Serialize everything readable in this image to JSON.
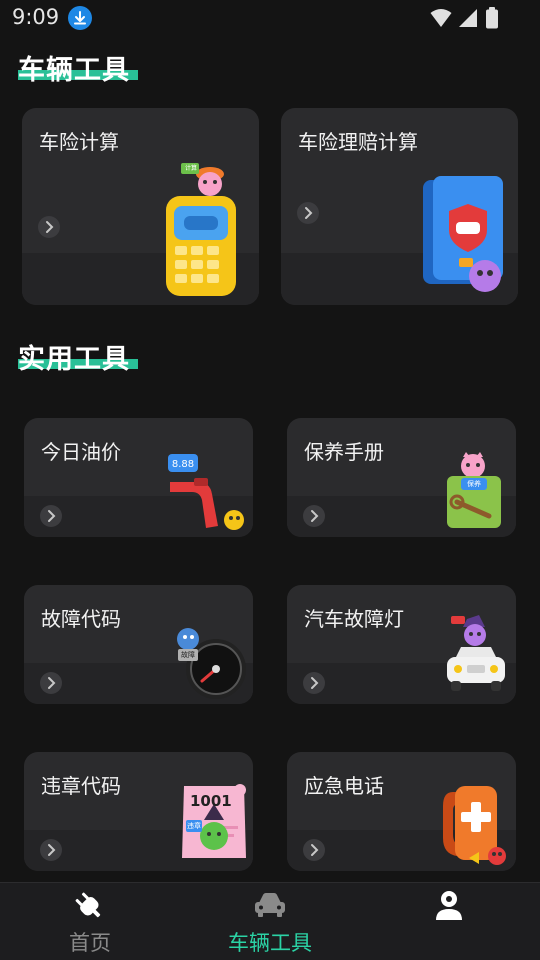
{
  "status_bar": {
    "time": "9:09"
  },
  "sections": {
    "vehicle_tools": {
      "title": "车辆工具"
    },
    "practical_tools": {
      "title": "实用工具"
    }
  },
  "cards": {
    "insurance_calc": {
      "label": "车险计算",
      "badge": "计算"
    },
    "claim_calc": {
      "label": "车险理赔计算"
    },
    "oil_price": {
      "label": "今日油价",
      "price_tag": "8.88"
    },
    "maintenance": {
      "label": "保养手册",
      "badge": "保养"
    },
    "fault_code": {
      "label": "故障代码",
      "badge": "故障"
    },
    "warning_light": {
      "label": "汽车故障灯",
      "badge": "故障"
    },
    "violation_code": {
      "label": "违章代码",
      "code": "1001",
      "badge": "违章"
    },
    "emergency": {
      "label": "应急电话"
    }
  },
  "bottom_nav": {
    "home": {
      "label": "首页"
    },
    "vehicle_tools": {
      "label": "车辆工具"
    },
    "profile": {
      "label": ""
    }
  },
  "colors": {
    "background": "#141414",
    "card": "#2b2b2d",
    "accent": "#2bd3a5",
    "nav_inactive": "#8a8a8a"
  }
}
